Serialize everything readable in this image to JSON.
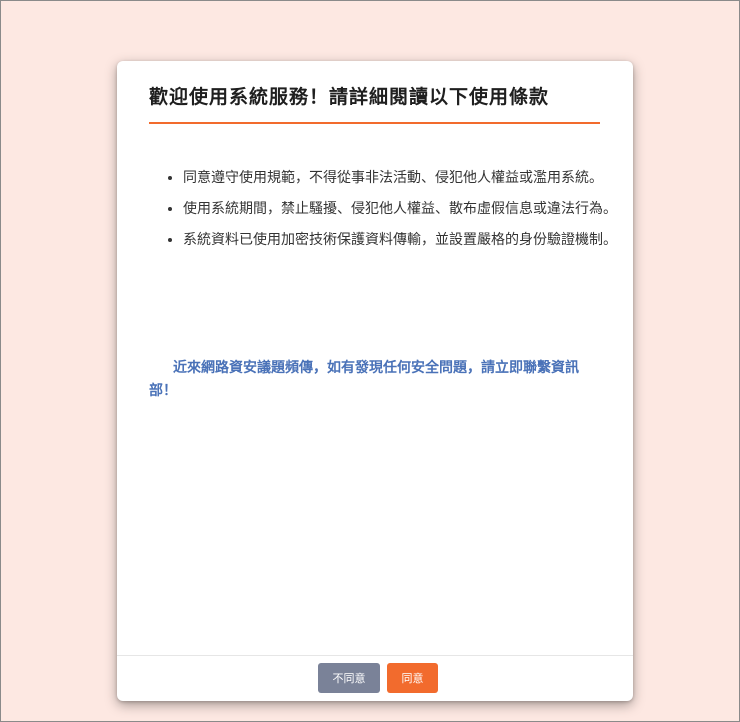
{
  "dialog": {
    "title": "歡迎使用系統服務！請詳細閱讀以下使用條款",
    "terms": [
      "同意遵守使用規範，不得從事非法活動、侵犯他人權益或濫用系統。",
      "使用系統期間，禁止騷擾、侵犯他人權益、散布虛假信息或違法行為。",
      "系統資料已使用加密技術保護資料傳輸，並設置嚴格的身份驗證機制。"
    ],
    "notice": "近來網路資安議題頻傳，如有發現任何安全問題，請立即聯繫資訊部！",
    "buttons": {
      "decline": "不同意",
      "accept": "同意"
    }
  },
  "colors": {
    "page_background": "#fde8e2",
    "accent": "#f26b2d",
    "notice_text": "#4a72b8",
    "decline_button": "#7a8298"
  }
}
